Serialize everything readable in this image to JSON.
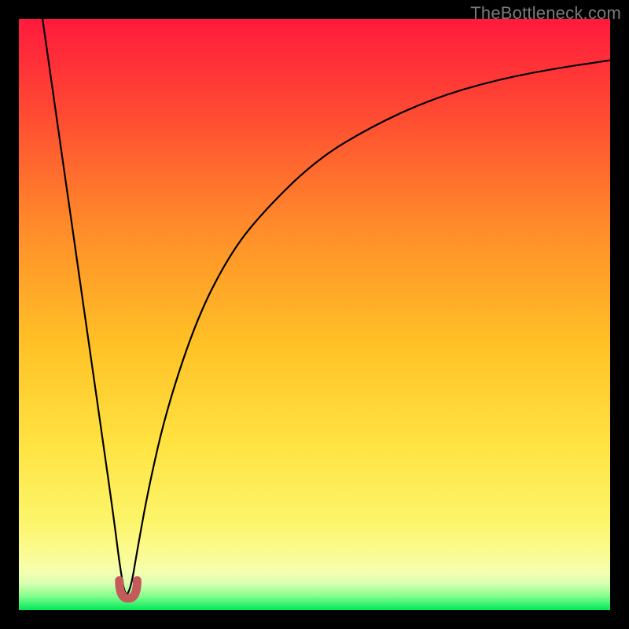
{
  "watermark": "TheBottleneck.com",
  "colors": {
    "bg": "#000000",
    "grad_top": "#ff1a3d",
    "grad_mid1": "#ff6a2a",
    "grad_mid2": "#ffb526",
    "grad_mid3": "#ffe342",
    "grad_mid4": "#fcf780",
    "grad_band": "#f6ffb0",
    "grad_bottom": "#00e85a",
    "curve_stroke": "#000000",
    "marker_stroke": "#c45a5a"
  },
  "chart_data": {
    "type": "line",
    "title": "",
    "xlabel": "",
    "ylabel": "",
    "xlim": [
      0,
      100
    ],
    "ylim": [
      0,
      100
    ],
    "grid": false,
    "legend": false,
    "minimum_x": 18,
    "series": [
      {
        "name": "bottleneck-curve",
        "x": [
          4,
          6,
          8,
          10,
          12,
          14,
          16,
          17,
          18,
          19,
          20,
          22,
          25,
          30,
          35,
          40,
          50,
          60,
          70,
          80,
          90,
          100
        ],
        "y": [
          100,
          86,
          72,
          58,
          44,
          30,
          16,
          8,
          2,
          4,
          10,
          21,
          34,
          49,
          59,
          66,
          76,
          82,
          86.5,
          89.5,
          91.5,
          93
        ]
      }
    ],
    "marker": {
      "name": "u-marker",
      "x_range": [
        17,
        20
      ],
      "y_range": [
        0,
        5
      ]
    },
    "annotations": []
  }
}
